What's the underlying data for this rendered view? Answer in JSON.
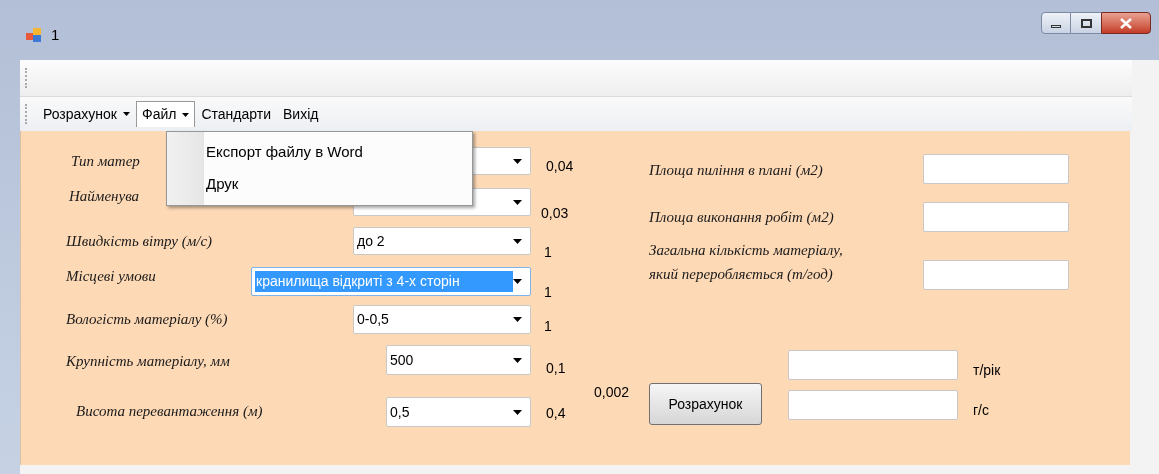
{
  "window": {
    "title": "1"
  },
  "menu": [
    {
      "label": "Розрахунок",
      "expanded": false
    },
    {
      "label": "Файл",
      "expanded": true
    },
    {
      "label": "Стандарти",
      "expanded": false
    },
    {
      "label": "Вихід",
      "expanded": false
    }
  ],
  "dropdown_menu": {
    "items": [
      "Експорт файлу в Word",
      "Друк"
    ]
  },
  "parameters": [
    {
      "label": "Тип матер",
      "coefficient": "0,04"
    },
    {
      "label": "Найменува",
      "coefficient": "0,03"
    },
    {
      "label": "Швидкість вітру (м/с)",
      "value": "до 2",
      "text_selected": false,
      "coefficient": "1"
    },
    {
      "label": "Місцеві умови",
      "value": "кранилища відкриті з 4-х сторін",
      "text_selected": true,
      "coefficient": "1"
    },
    {
      "label": "Вологість матеріалу (%)",
      "value": "0-0,5",
      "text_selected": false,
      "coefficient": "1"
    },
    {
      "label": "Крупність матеріалу, мм",
      "value": "500",
      "text_selected": false,
      "coefficient": "0,1"
    },
    {
      "label": "Висота перевантаження (м)",
      "value": "0,5",
      "text_selected": false,
      "coefficient": "0,4"
    }
  ],
  "area_fields": [
    {
      "label": "Площа пиління в плані (м2)"
    },
    {
      "label": "Площа виконання робіт (м2)"
    },
    {
      "label": "Загальна кількість матеріалу,\nякий переробляється (т/год)"
    }
  ],
  "result": {
    "coefficient": "0,002",
    "button": "Розрахунок",
    "outputs": [
      {
        "unit": "т/рік"
      },
      {
        "unit": "г/с"
      }
    ]
  }
}
